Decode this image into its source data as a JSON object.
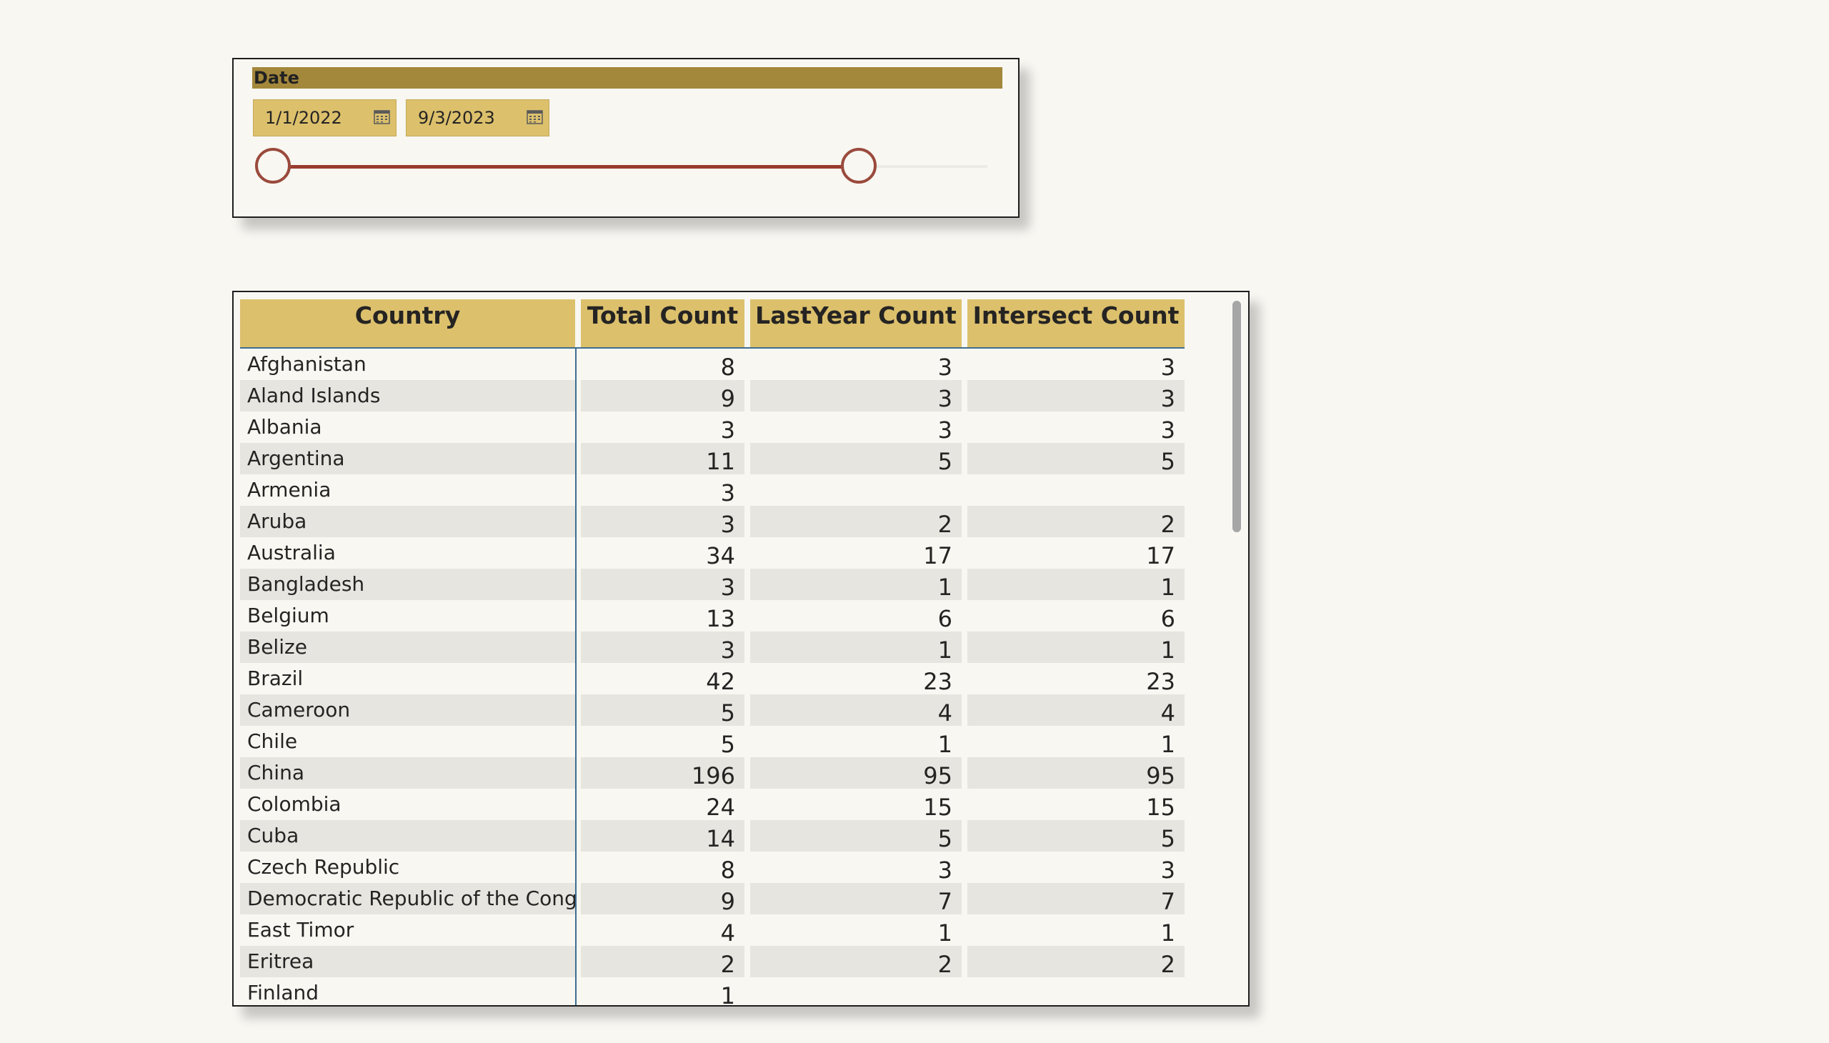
{
  "slicer": {
    "title": "Date",
    "start_date": "1/1/2022",
    "end_date": "9/3/2023",
    "range_fraction": {
      "start": 0.0,
      "end": 0.82
    }
  },
  "table": {
    "columns": [
      "Country",
      "Total Count",
      "LastYear Count",
      "Intersect Count"
    ],
    "rows": [
      {
        "country": "Afghanistan",
        "total": "8",
        "last": "3",
        "inter": "3"
      },
      {
        "country": "Aland Islands",
        "total": "9",
        "last": "3",
        "inter": "3"
      },
      {
        "country": "Albania",
        "total": "3",
        "last": "3",
        "inter": "3"
      },
      {
        "country": "Argentina",
        "total": "11",
        "last": "5",
        "inter": "5"
      },
      {
        "country": "Armenia",
        "total": "3",
        "last": "",
        "inter": ""
      },
      {
        "country": "Aruba",
        "total": "3",
        "last": "2",
        "inter": "2"
      },
      {
        "country": "Australia",
        "total": "34",
        "last": "17",
        "inter": "17"
      },
      {
        "country": "Bangladesh",
        "total": "3",
        "last": "1",
        "inter": "1"
      },
      {
        "country": "Belgium",
        "total": "13",
        "last": "6",
        "inter": "6"
      },
      {
        "country": "Belize",
        "total": "3",
        "last": "1",
        "inter": "1"
      },
      {
        "country": "Brazil",
        "total": "42",
        "last": "23",
        "inter": "23"
      },
      {
        "country": "Cameroon",
        "total": "5",
        "last": "4",
        "inter": "4"
      },
      {
        "country": "Chile",
        "total": "5",
        "last": "1",
        "inter": "1"
      },
      {
        "country": "China",
        "total": "196",
        "last": "95",
        "inter": "95"
      },
      {
        "country": "Colombia",
        "total": "24",
        "last": "15",
        "inter": "15"
      },
      {
        "country": "Cuba",
        "total": "14",
        "last": "5",
        "inter": "5"
      },
      {
        "country": "Czech Republic",
        "total": "8",
        "last": "3",
        "inter": "3"
      },
      {
        "country": "Democratic Republic of the Congo",
        "total": "9",
        "last": "7",
        "inter": "7"
      },
      {
        "country": "East Timor",
        "total": "4",
        "last": "1",
        "inter": "1"
      },
      {
        "country": "Eritrea",
        "total": "2",
        "last": "2",
        "inter": "2"
      },
      {
        "country": "Finland",
        "total": "1",
        "last": "",
        "inter": ""
      }
    ]
  },
  "colors": {
    "header_bg": "#dcc06c",
    "slicer_title_bg": "#a3873b",
    "slider_fill": "#9a3b2f",
    "row_alt": "#e6e5e0",
    "page_bg": "#f8f7f2"
  }
}
